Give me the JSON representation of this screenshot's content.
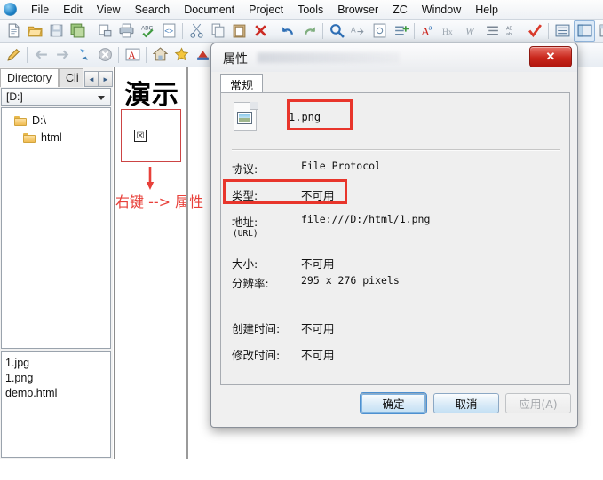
{
  "menubar": {
    "app_icon": "globe-icon",
    "items": [
      {
        "label": "File"
      },
      {
        "label": "Edit"
      },
      {
        "label": "View"
      },
      {
        "label": "Search"
      },
      {
        "label": "Document"
      },
      {
        "label": "Project"
      },
      {
        "label": "Tools"
      },
      {
        "label": "Browser"
      },
      {
        "label": "ZC"
      },
      {
        "label": "Window"
      },
      {
        "label": "Help"
      }
    ]
  },
  "toolbar_row1": {
    "buttons": [
      {
        "icon": "new-file-icon"
      },
      {
        "icon": "open-folder-icon"
      },
      {
        "icon": "save-icon"
      },
      {
        "icon": "save-all-icon"
      },
      {
        "sep": true
      },
      {
        "icon": "print-preview-icon"
      },
      {
        "icon": "print-icon"
      },
      {
        "icon": "spellcheck-icon"
      },
      {
        "icon": "code-view-icon"
      },
      {
        "sep": true
      },
      {
        "icon": "cut-icon"
      },
      {
        "icon": "copy-icon"
      },
      {
        "icon": "paste-icon"
      },
      {
        "icon": "delete-icon"
      },
      {
        "sep": true
      },
      {
        "icon": "undo-icon"
      },
      {
        "icon": "redo-icon"
      },
      {
        "sep": true
      },
      {
        "icon": "search-icon"
      },
      {
        "icon": "replace-icon"
      },
      {
        "icon": "goto-icon"
      },
      {
        "icon": "insert-line-icon"
      },
      {
        "sep": true
      },
      {
        "icon": "font-color-icon"
      },
      {
        "icon": "hx-icon"
      },
      {
        "icon": "italic-w-icon"
      },
      {
        "icon": "align-icon"
      },
      {
        "icon": "abc-case-icon"
      },
      {
        "icon": "check-icon"
      },
      {
        "sep": true
      },
      {
        "icon": "panel-list-icon"
      },
      {
        "icon": "panel-split-icon"
      },
      {
        "icon": "panel-preview-icon"
      },
      {
        "icon": "external-browser-icon"
      },
      {
        "sep": true
      },
      {
        "icon": "cursor-icon"
      }
    ]
  },
  "toolbar_row2": {
    "buttons": [
      {
        "icon": "pencil-icon"
      },
      {
        "sep": true
      },
      {
        "icon": "back-arrow-icon"
      },
      {
        "icon": "forward-arrow-icon"
      },
      {
        "icon": "refresh-icon"
      },
      {
        "icon": "stop-icon"
      },
      {
        "sep": true
      },
      {
        "icon": "font-a-icon"
      },
      {
        "sep": true
      },
      {
        "icon": "home-icon"
      },
      {
        "icon": "favorites-star-icon"
      },
      {
        "icon": "color-palette-icon"
      },
      {
        "sep": true
      }
    ]
  },
  "sidebar": {
    "tabs": [
      {
        "label": "Directory",
        "active": true
      },
      {
        "label": "Cli",
        "active": false
      }
    ],
    "nav_prev": "◄",
    "nav_next": "►",
    "drive_selector": {
      "value": "[D:]"
    },
    "tree": [
      {
        "label": "D:\\",
        "level": 0,
        "icon": "folder-icon"
      },
      {
        "label": "html",
        "level": 1,
        "icon": "folder-open-icon"
      }
    ],
    "files": [
      {
        "label": "1.jpg"
      },
      {
        "label": "1.png"
      },
      {
        "label": "demo.html"
      }
    ]
  },
  "browser_content": {
    "heading": "演示",
    "broken_image_alt": "☒",
    "annotation_text": "右键 --> 属性",
    "annotation_color": "#e8403a",
    "question_mark_color": "#f03a2e"
  },
  "dialog": {
    "title": "属性",
    "close_label": "✕",
    "tab_label": "常规",
    "file_icon": "image-file-icon",
    "file_name": "1.png",
    "properties": [
      {
        "label": "协议:",
        "sublabel": "",
        "value": "File Protocol",
        "cjk": false,
        "highlight": false
      },
      {
        "label": "类型:",
        "sublabel": "",
        "value": "不可用",
        "cjk": true,
        "highlight": true
      },
      {
        "label": "地址:",
        "sublabel": "(URL)",
        "value": "file:///D:/html/1.png",
        "cjk": false,
        "highlight": false
      },
      {
        "label": "大小:",
        "sublabel": "",
        "value": "不可用",
        "cjk": true,
        "highlight": false
      },
      {
        "label": "分辨率:",
        "sublabel": "",
        "value": "295  x  276  pixels",
        "cjk": false,
        "highlight": false
      },
      {
        "label": "创建时间:",
        "sublabel": "",
        "value": "不可用",
        "cjk": true,
        "highlight": false
      },
      {
        "label": "修改时间:",
        "sublabel": "",
        "value": "不可用",
        "cjk": true,
        "highlight": false
      }
    ],
    "buttons": {
      "ok": "确定",
      "cancel": "取消",
      "apply": "应用(A)"
    },
    "annotation_box_color": "#e8352b"
  }
}
